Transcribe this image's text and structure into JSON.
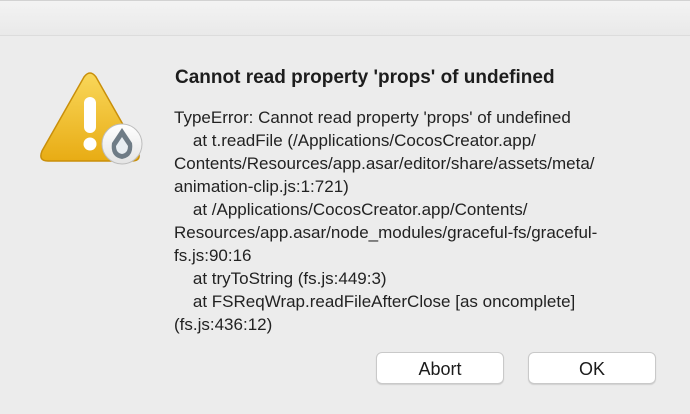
{
  "dialog": {
    "title": "Cannot read property 'props' of undefined",
    "message_lines": [
      "TypeError: Cannot read property 'props' of undefined",
      "    at t.readFile (/Applications/CocosCreator.app/",
      "Contents/Resources/app.asar/editor/share/assets/meta/",
      "animation-clip.js:1:721)",
      "    at /Applications/CocosCreator.app/Contents/",
      "Resources/app.asar/node_modules/graceful-fs/graceful-",
      "fs.js:90:16",
      "    at tryToString (fs.js:449:3)",
      "    at FSReqWrap.readFileAfterClose [as oncomplete]",
      "(fs.js:436:12)"
    ],
    "icon": "warning-triangle-icon",
    "app_badge_icon": "cocos-creator-icon",
    "warning_color": "#f2c12e"
  },
  "buttons": {
    "abort_label": "Abort",
    "ok_label": "OK"
  }
}
